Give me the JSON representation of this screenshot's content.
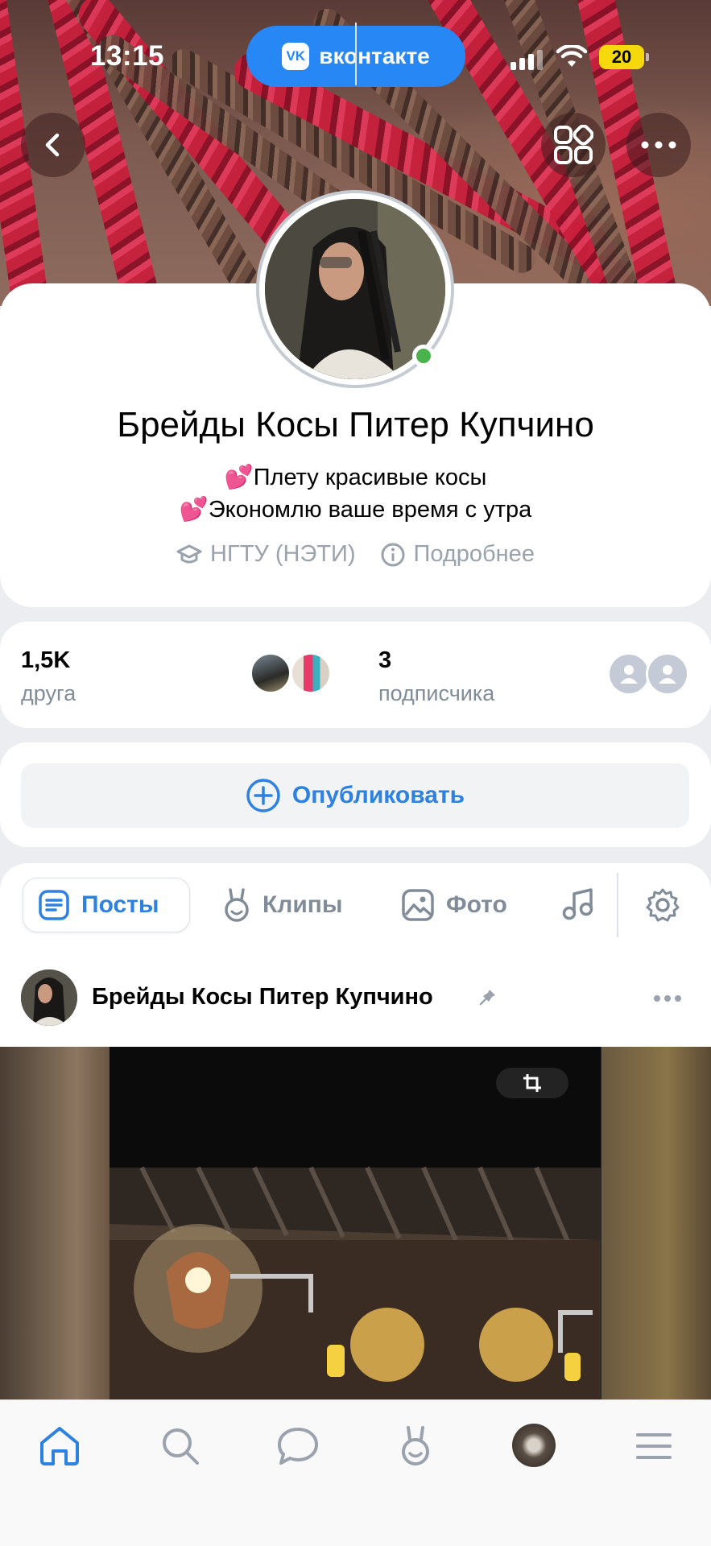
{
  "status_bar": {
    "time": "13:15",
    "app_pill": "вконтакте",
    "app_logo": "VK",
    "battery": "20"
  },
  "profile": {
    "name": "Брейды Косы Питер Купчино",
    "bio_line1": "💕Плету красивые косы",
    "bio_line2": "💕Экономлю ваше время с утра",
    "education": "НГТУ (НЭТИ)",
    "more_label": "Подробнее",
    "online": true
  },
  "stats": {
    "friends_count": "1,5K",
    "friends_label": "друга",
    "followers_count": "3",
    "followers_label": "подписчика"
  },
  "publish": {
    "label": "Опубликовать"
  },
  "tabs": [
    {
      "label": "Посты",
      "icon": "posts-icon",
      "active": true
    },
    {
      "label": "Клипы",
      "icon": "clips-icon",
      "active": false
    },
    {
      "label": "Фото",
      "icon": "photo-icon",
      "active": false
    },
    {
      "label": "",
      "icon": "music-icon",
      "active": false
    }
  ],
  "post": {
    "author": "Брейды Косы Питер Купчино",
    "pinned": true
  },
  "bottom_nav": [
    "home-icon",
    "search-icon",
    "messages-icon",
    "clips-icon",
    "profile-avatar",
    "menu-icon"
  ],
  "colors": {
    "accent": "#2d81e0",
    "vk_blue": "#2787f5",
    "online": "#4bb34b",
    "muted": "#818c99"
  }
}
